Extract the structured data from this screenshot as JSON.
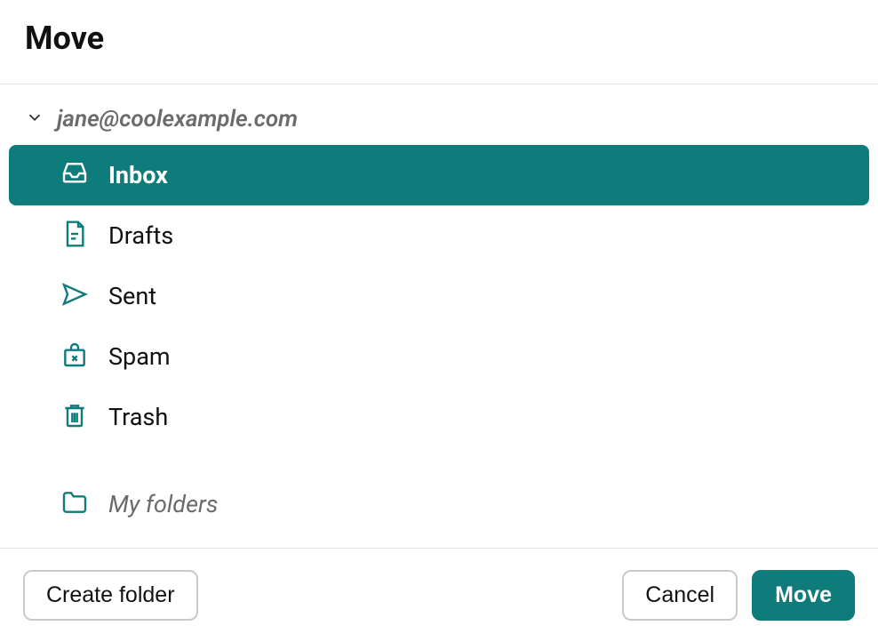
{
  "dialog": {
    "title": "Move"
  },
  "account": {
    "email": "jane@coolexample.com"
  },
  "folders": {
    "inbox": "Inbox",
    "drafts": "Drafts",
    "sent": "Sent",
    "spam": "Spam",
    "trash": "Trash",
    "my_folders": "My folders"
  },
  "selected_folder": "inbox",
  "actions": {
    "create_folder": "Create folder",
    "cancel": "Cancel",
    "move": "Move"
  },
  "colors": {
    "accent": "#0e7c7b"
  }
}
